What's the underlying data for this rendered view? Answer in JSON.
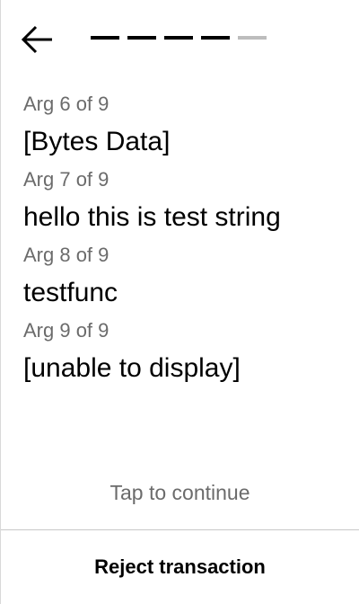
{
  "nav": {
    "back_icon": "arrow-left-icon",
    "progress_steps_total": 5,
    "progress_steps_active": 4
  },
  "args": [
    {
      "label": "Arg 6 of 9",
      "value": "[Bytes Data]"
    },
    {
      "label": "Arg 7 of 9",
      "value": "hello this is test string"
    },
    {
      "label": "Arg 8 of 9",
      "value": "testfunc"
    },
    {
      "label": "Arg 9 of 9",
      "value": "[unable to display]"
    }
  ],
  "footer": {
    "tap_hint": "Tap to continue",
    "reject_label": "Reject transaction"
  },
  "colors": {
    "primary_text": "#000000",
    "secondary_text": "#6b6b6b",
    "progress_inactive": "#bdbdbd",
    "divider": "#c8c8c8"
  }
}
